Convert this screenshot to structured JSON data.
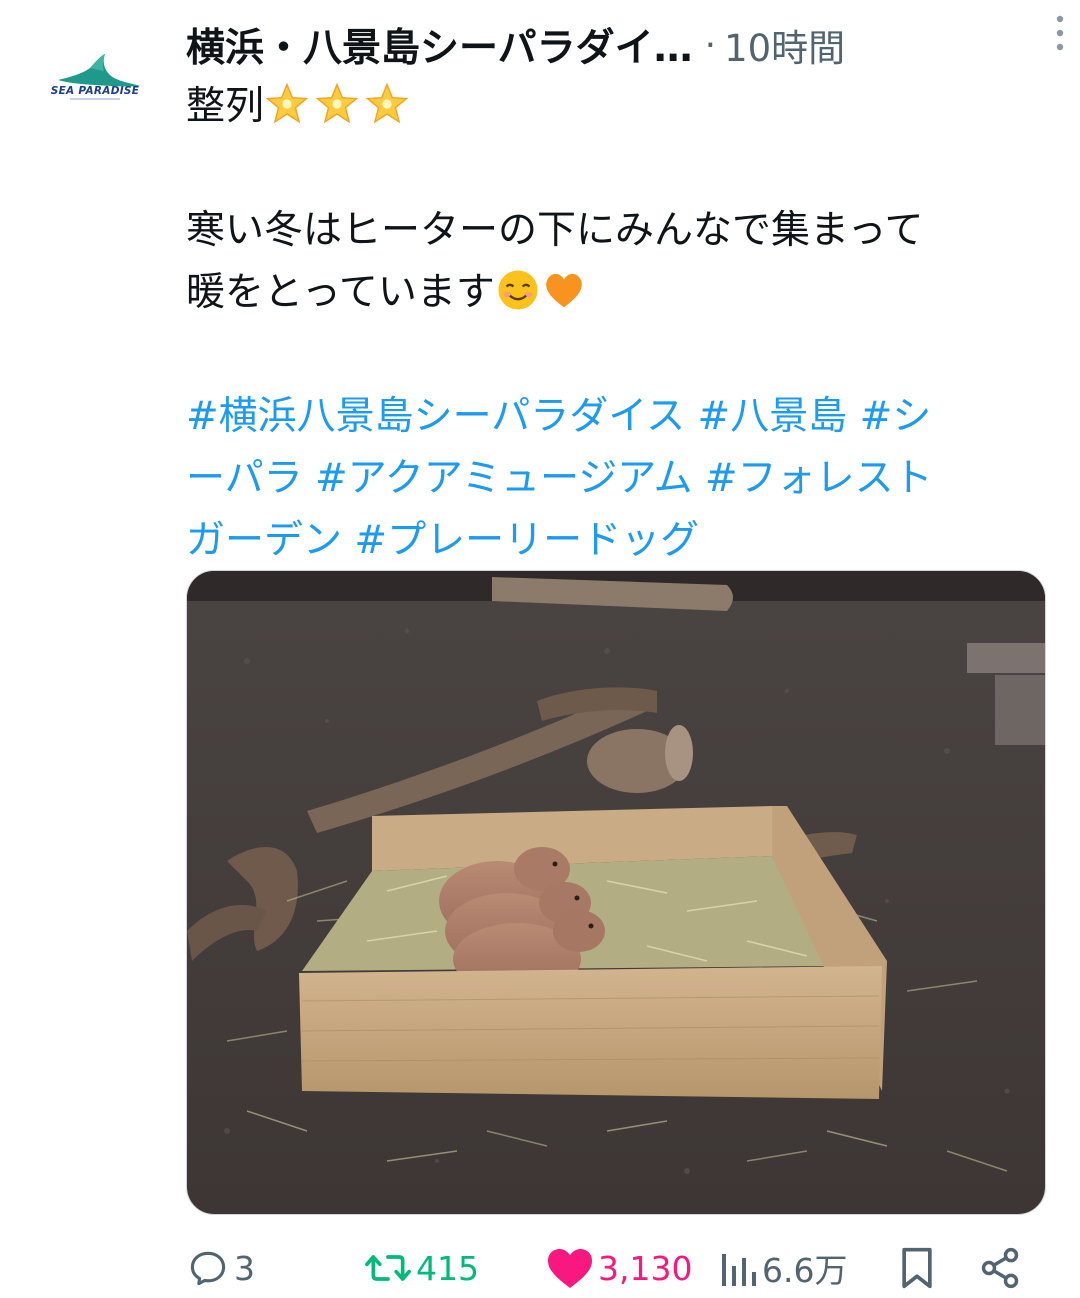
{
  "tweet": {
    "author": {
      "display_name": "横浜・八景島シーパラダイ…",
      "avatar_logo_text": "SEA PARADISE",
      "avatar_icon": "sea-paradise-logo-icon"
    },
    "separator": "·",
    "timestamp": "10時間",
    "more_icon": "more-vertical-icon",
    "text_lines": [
      "整列",
      "寒い冬はヒーターの下にみんなで集まって",
      "暖をとっています"
    ],
    "hashtags_lines": [
      [
        "#横浜八景島シーパラダイス",
        "#八景島",
        "#シ"
      ],
      [
        "ーパラ",
        "#アクアミュージアム",
        "#フォレスト"
      ],
      [
        "ガーデン",
        "#プレーリードッグ"
      ]
    ],
    "emojis": [
      "glowing-star-emoji",
      "glowing-star-emoji",
      "glowing-star-emoji",
      "smiling-face-emoji",
      "orange-heart-emoji"
    ],
    "media_icon": "photo-prairie-dogs"
  },
  "actions": {
    "reply": {
      "icon": "reply-icon",
      "count": "3"
    },
    "retweet": {
      "icon": "retweet-icon",
      "count": "415"
    },
    "like": {
      "icon": "heart-icon",
      "count": "3,130"
    },
    "views": {
      "icon": "views-chart-icon",
      "count": "6.6万"
    },
    "bookmark": {
      "icon": "bookmark-icon"
    },
    "share": {
      "icon": "share-icon"
    }
  },
  "colors": {
    "link": "#1d9bf0",
    "muted": "#536471",
    "retweet": "#00ba7c",
    "like": "#f91880",
    "logo_teal": "#1f9a8a",
    "logo_navy": "#1d3f8f"
  }
}
